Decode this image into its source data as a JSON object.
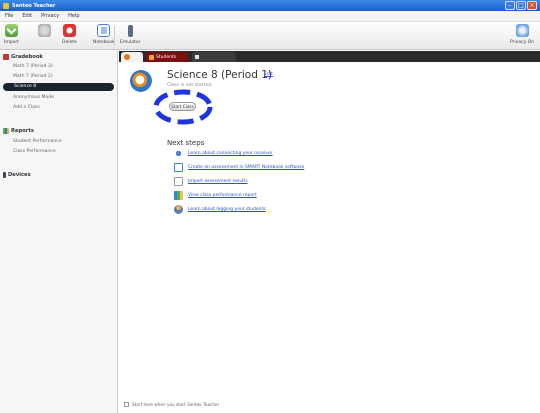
{
  "window": {
    "title": "Senteo Teacher"
  },
  "menu": [
    "File",
    "Edit",
    "Privacy",
    "Help"
  ],
  "toolbar": {
    "import": "Import",
    "delete": "Delete",
    "notebook": "Notebook",
    "emulator": "Emulator",
    "privacy": "Privacy On"
  },
  "sidebar": {
    "gradebook": {
      "header": "Gradebook",
      "items": [
        "Math 7 (Period 3)",
        "Math 7 (Period 2)",
        "Science 8",
        "Anonymous Mode",
        "Add a Class"
      ],
      "selected_index": 2
    },
    "reports": {
      "header": "Reports",
      "items": [
        "Student Performance",
        "Class Performance"
      ]
    },
    "devices": {
      "header": "Devices"
    }
  },
  "tabs": {
    "students": "Students"
  },
  "class": {
    "title": "Science 8 (Period 1)",
    "edit": "Edit",
    "status": "Class is not started.",
    "start_button": "Start Class"
  },
  "next_steps": {
    "heading": "Next steps",
    "items": [
      "Learn about connecting your receiver",
      "Create an assessment in SMART Notebook software",
      "Import assessment results",
      "View class performance report",
      "Learn about logging your students"
    ]
  },
  "footer": {
    "checkbox_label": "Start here when you start Senteo Teacher"
  },
  "colors": {
    "accent": "#1a5fd0",
    "highlight_ring": "#1f35e0",
    "selected": "#1c2330",
    "link": "#2d4fc8"
  },
  "icons": {
    "import": "import-arrow-icon",
    "delete": "delete-icon",
    "notebook": "notebook-icon",
    "emulator": "emulator-remote-icon",
    "privacy": "privacy-icon"
  }
}
